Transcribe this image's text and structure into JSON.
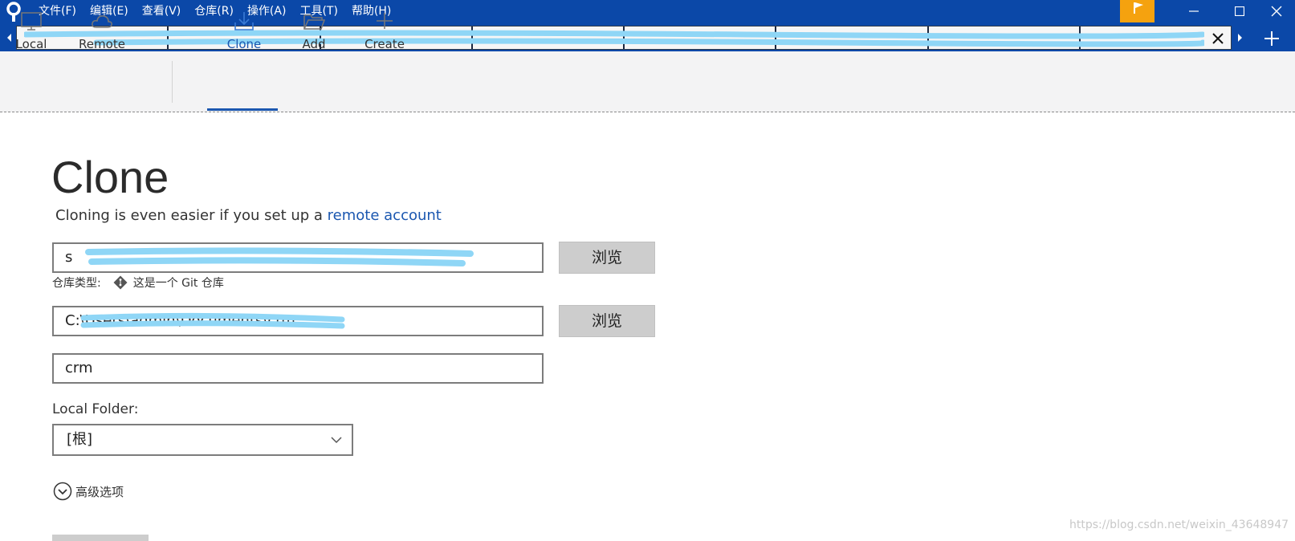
{
  "titlebar": {
    "app_icon": "sourcetree-logo-icon",
    "menu": [
      "文件(F)",
      "编辑(E)",
      "查看(V)",
      "仓库(R)",
      "操作(A)",
      "工具(T)",
      "帮助(H)"
    ],
    "flag_icon": "flag-icon",
    "accent_color": "#0b48a8",
    "flag_color": "#f5a20f"
  },
  "tabs": {
    "count": 8,
    "close_icon": "close-icon",
    "add_icon": "plus-icon"
  },
  "toolbar": {
    "local": "Local",
    "remote": "Remote",
    "clone": "Clone",
    "add": "Add",
    "create": "Create",
    "active": "Clone"
  },
  "main": {
    "title": "Clone",
    "subtitle_prefix": "Cloning is even easier if you set up a",
    "subtitle_link": "remote account",
    "source_url_value": "s",
    "browse_label": "浏览",
    "repo_type_label": "仓库类型:",
    "repo_type_value": "这是一个 Git 仓库",
    "dest_path_value": "C:\\Users\\admin\\Documents\\crm",
    "name_value": "crm",
    "local_folder_label": "Local Folder:",
    "local_folder_value": "[根]",
    "advanced_label": "高级选项"
  },
  "watermark": "https://blog.csdn.net/weixin_43648947"
}
